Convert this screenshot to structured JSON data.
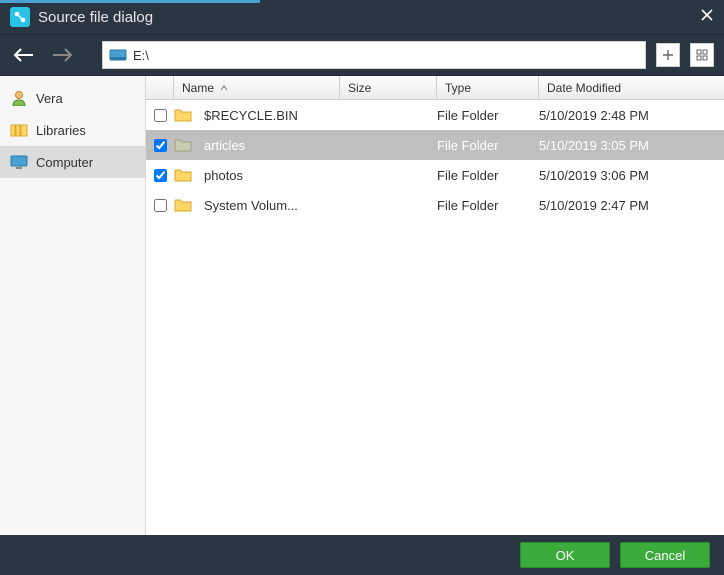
{
  "title": "Source file dialog",
  "path": "E:\\",
  "sidebar": {
    "items": [
      {
        "label": "Vera"
      },
      {
        "label": "Libraries"
      },
      {
        "label": "Computer"
      }
    ],
    "selected_index": 2
  },
  "columns": {
    "name": "Name",
    "size": "Size",
    "type": "Type",
    "date": "Date Modified"
  },
  "rows": [
    {
      "checked": false,
      "selected": false,
      "name": "$RECYCLE.BIN",
      "size": "",
      "type": "File Folder",
      "date": "5/10/2019 2:48 PM"
    },
    {
      "checked": true,
      "selected": true,
      "name": "articles",
      "size": "",
      "type": "File Folder",
      "date": "5/10/2019 3:05 PM"
    },
    {
      "checked": true,
      "selected": false,
      "name": "photos",
      "size": "",
      "type": "File Folder",
      "date": "5/10/2019 3:06 PM"
    },
    {
      "checked": false,
      "selected": false,
      "name": "System Volum...",
      "size": "",
      "type": "File Folder",
      "date": "5/10/2019 2:47 PM"
    }
  ],
  "buttons": {
    "ok": "OK",
    "cancel": "Cancel"
  }
}
